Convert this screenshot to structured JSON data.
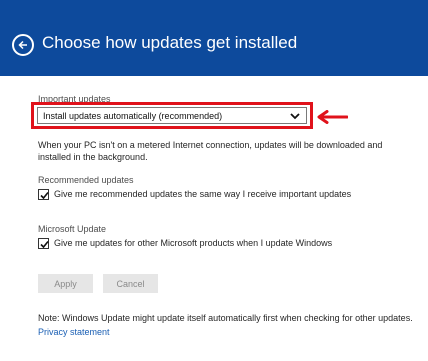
{
  "header": {
    "title": "Choose how updates get installed",
    "back_icon": "back-arrow-icon",
    "background": "#0d4a9c"
  },
  "important_updates": {
    "label": "Important updates",
    "selected": "Install updates automatically (recommended)",
    "description": "When your PC isn't on a metered Internet connection, updates will be downloaded and installed in the background."
  },
  "recommended_updates": {
    "label": "Recommended updates",
    "checkbox_label": "Give me recommended updates the same way I receive important updates",
    "checked": true
  },
  "microsoft_update": {
    "label": "Microsoft Update",
    "checkbox_label": "Give me updates for other Microsoft products when I update Windows",
    "checked": true
  },
  "buttons": {
    "apply": "Apply",
    "cancel": "Cancel"
  },
  "note": "Note: Windows Update might update itself automatically first when checking for other updates.",
  "privacy_link": "Privacy statement",
  "annotation_color": "#e0121b"
}
